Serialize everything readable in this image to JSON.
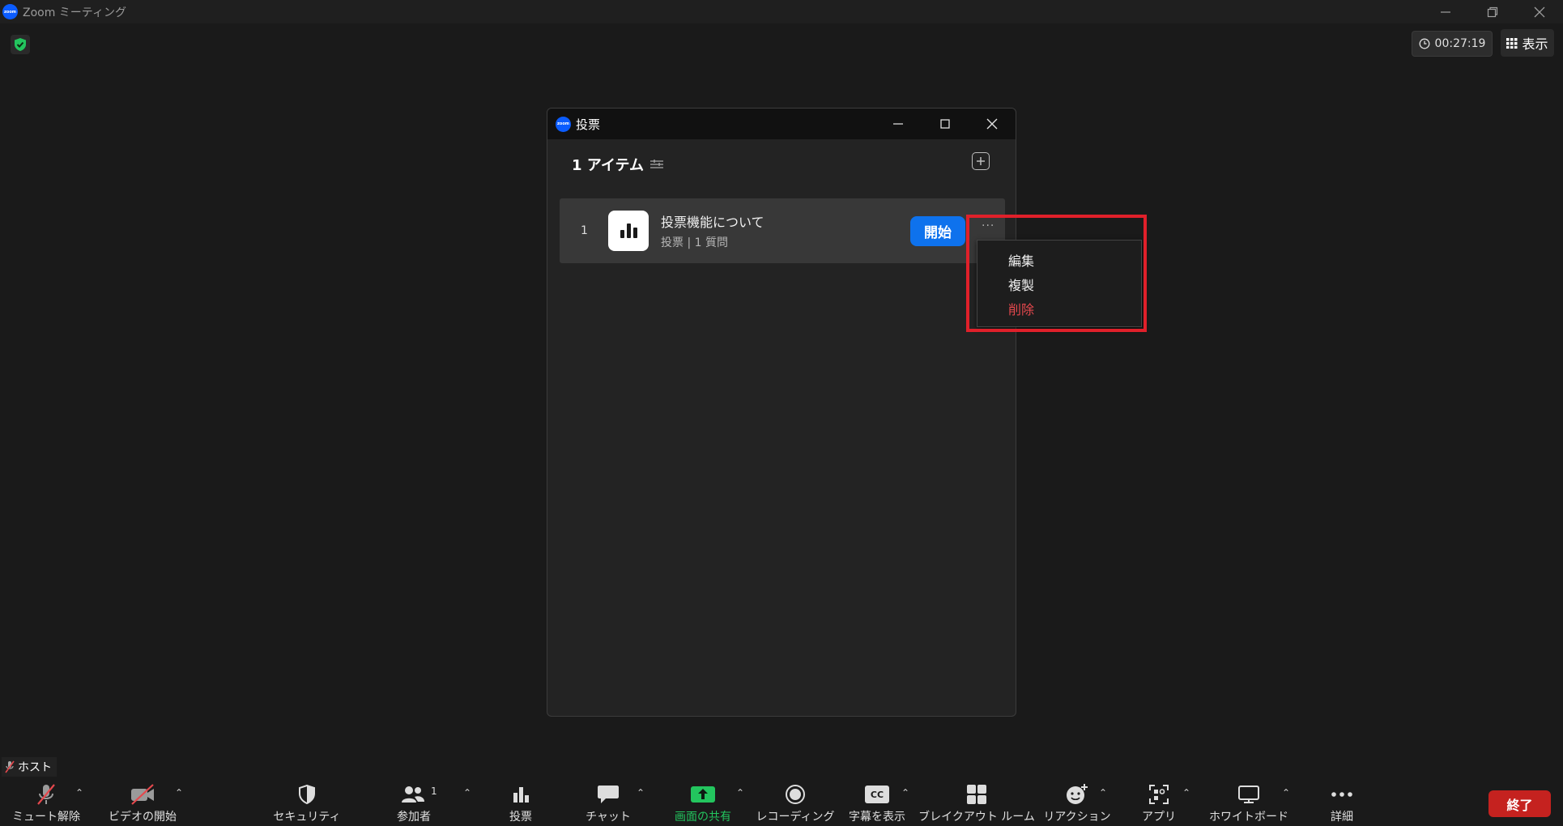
{
  "window": {
    "title": "Zoom ミーティング",
    "logo_text": "zoom"
  },
  "overlay": {
    "timer": "00:27:19",
    "view_label": "表示"
  },
  "poll_window": {
    "title": "投票",
    "items_header": "1 アイテム",
    "item": {
      "number": "1",
      "title": "投票機能について",
      "subtitle": "投票 | 1 質問",
      "start_label": "開始",
      "more_label": "···"
    }
  },
  "context_menu": {
    "items": [
      {
        "label": "編集",
        "danger": false
      },
      {
        "label": "複製",
        "danger": false
      },
      {
        "label": "削除",
        "danger": true
      }
    ]
  },
  "host_badge": "ホスト",
  "toolbar": {
    "items": [
      {
        "label": "ミュート解除",
        "icon": "mic-off-icon"
      },
      {
        "label": "ビデオの開始",
        "icon": "video-off-icon"
      },
      {
        "label": "セキュリティ",
        "icon": "shield-icon"
      },
      {
        "label": "参加者",
        "icon": "participants-icon",
        "count": "1"
      },
      {
        "label": "投票",
        "icon": "poll-icon"
      },
      {
        "label": "チャット",
        "icon": "chat-icon"
      },
      {
        "label": "画面の共有",
        "icon": "share-screen-icon"
      },
      {
        "label": "レコーディング",
        "icon": "record-icon"
      },
      {
        "label": "字幕を表示",
        "icon": "cc-icon",
        "icon_text": "CC"
      },
      {
        "label": "ブレイクアウト ルーム",
        "icon": "breakout-icon"
      },
      {
        "label": "リアクション",
        "icon": "reaction-icon"
      },
      {
        "label": "アプリ",
        "icon": "apps-icon"
      },
      {
        "label": "ホワイトボード",
        "icon": "whiteboard-icon"
      },
      {
        "label": "詳細",
        "icon": "more-icon"
      }
    ],
    "end_label": "終了"
  },
  "colors": {
    "accent_blue": "#0e72ed",
    "share_green": "#23c55e",
    "danger_red": "#e5484d",
    "end_red": "#c5221f",
    "highlight_red": "#e0202a"
  }
}
